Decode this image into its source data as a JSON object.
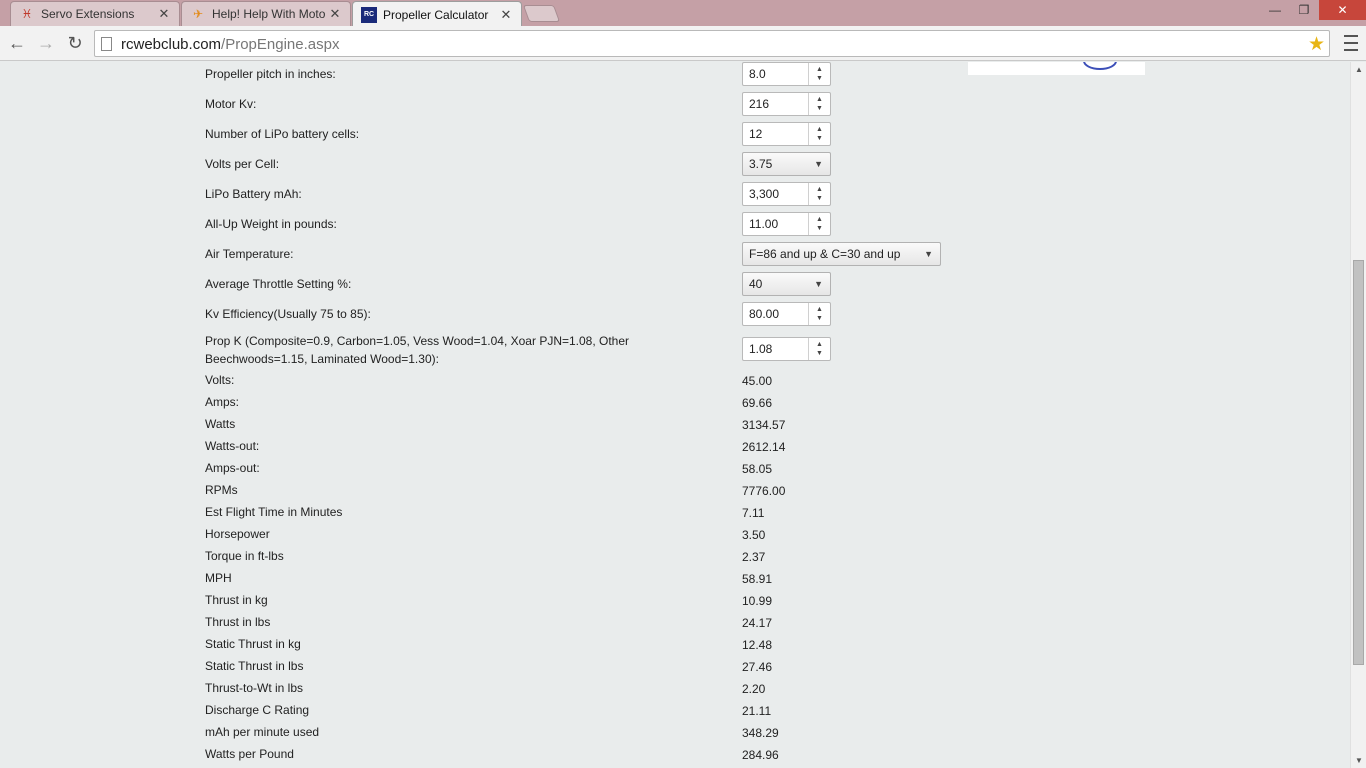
{
  "browser": {
    "tabs": [
      {
        "title": "Servo Extensions",
        "icon": "rc-logo-icon"
      },
      {
        "title": "Help! Help With Moto",
        "icon": "plane-icon"
      },
      {
        "title": "Propeller Calculator",
        "icon": "rc-logo-icon",
        "active": true
      }
    ],
    "url_host": "rcwebclub.com",
    "url_path": "/PropEngine.aspx",
    "accent_color": "#e8b514"
  },
  "form": {
    "inputs": [
      {
        "label": "Propeller pitch in inches:",
        "value": "8.0",
        "kind": "spinner"
      },
      {
        "label": "Motor Kv:",
        "value": "216",
        "kind": "spinner"
      },
      {
        "label": "Number of LiPo battery cells:",
        "value": "12",
        "kind": "spinner"
      },
      {
        "label": "Volts per Cell:",
        "value": "3.75",
        "kind": "select"
      },
      {
        "label": "LiPo Battery mAh:",
        "value": "3,300",
        "kind": "spinner"
      },
      {
        "label": "All-Up Weight in pounds:",
        "value": "11.00",
        "kind": "spinner"
      },
      {
        "label": "Air Temperature:",
        "value": "F=86 and up & C=30 and up",
        "kind": "select"
      },
      {
        "label": "Average Throttle Setting %:",
        "value": "40",
        "kind": "select"
      },
      {
        "label": "Kv Efficiency(Usually 75 to 85):",
        "value": "80.00",
        "kind": "spinner"
      },
      {
        "label": "Prop K (Composite=0.9, Carbon=1.05, Vess Wood=1.04, Xoar PJN=1.08, Other Beechwoods=1.15, Laminated Wood=1.30):",
        "value": "1.08",
        "kind": "spinner"
      }
    ]
  },
  "results": [
    {
      "label": "Volts:",
      "value": "45.00"
    },
    {
      "label": "Amps:",
      "value": "69.66"
    },
    {
      "label": "Watts",
      "value": "3134.57"
    },
    {
      "label": "Watts-out:",
      "value": "2612.14"
    },
    {
      "label": "Amps-out:",
      "value": "58.05"
    },
    {
      "label": "RPMs",
      "value": "7776.00"
    },
    {
      "label": "Est Flight Time in Minutes",
      "value": "7.11"
    },
    {
      "label": "Horsepower",
      "value": "3.50"
    },
    {
      "label": "Torque in ft-lbs",
      "value": "2.37"
    },
    {
      "label": "MPH",
      "value": "58.91"
    },
    {
      "label": "Thrust in kg",
      "value": "10.99"
    },
    {
      "label": "Thrust in lbs",
      "value": "24.17"
    },
    {
      "label": "Static Thrust in kg",
      "value": "12.48"
    },
    {
      "label": "Static Thrust in lbs",
      "value": "27.46"
    },
    {
      "label": "Thrust-to-Wt in lbs",
      "value": "2.20"
    },
    {
      "label": "Discharge C Rating",
      "value": "21.11"
    },
    {
      "label": "mAh per minute used",
      "value": "348.29"
    },
    {
      "label": "Watts per Pound",
      "value": "284.96"
    }
  ]
}
